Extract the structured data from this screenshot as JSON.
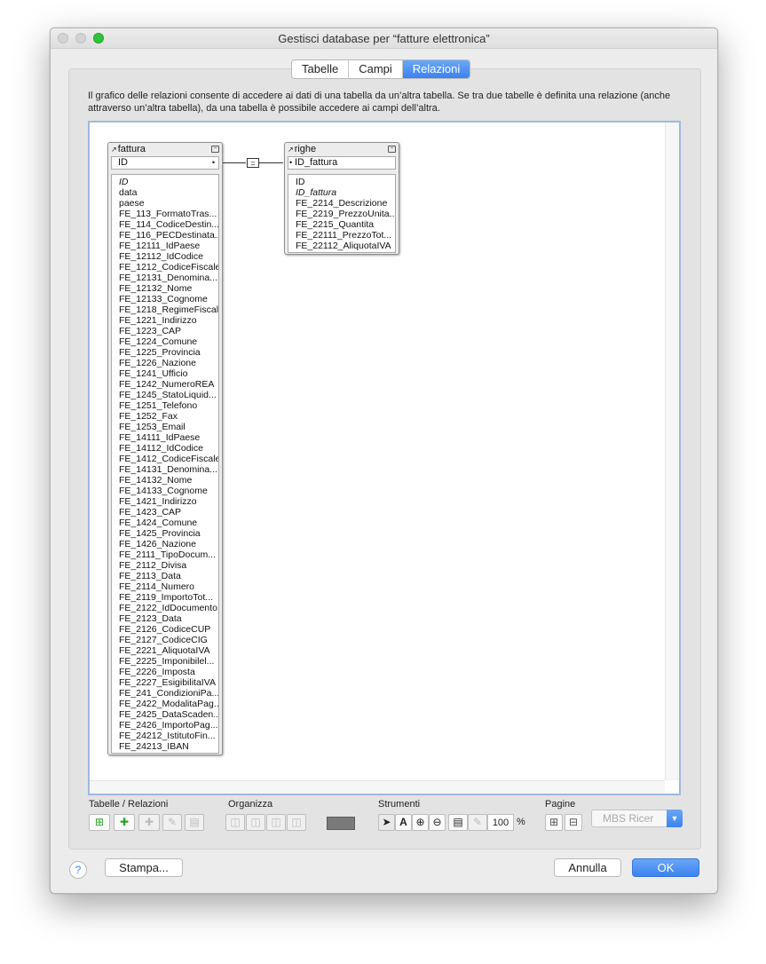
{
  "window": {
    "title": "Gestisci database per “fatture elettronica”"
  },
  "tabs": [
    {
      "label": "Tabelle",
      "active": false
    },
    {
      "label": "Campi",
      "active": false
    },
    {
      "label": "Relazioni",
      "active": true
    }
  ],
  "description": "Il grafico delle relazioni consente di accedere ai dati di una tabella da un’altra tabella. Se tra due tabelle è definita una relazione (anche attraverso un’altra tabella), da una tabella è possibile accedere ai campi dell’altra.",
  "tables": {
    "fattura": {
      "name": "fattura",
      "key_field": "ID",
      "fields": [
        "ID",
        "data",
        "paese",
        "FE_113_FormatoTras...",
        "FE_114_CodiceDestin...",
        "FE_116_PECDestinata...",
        "FE_12111_IdPaese",
        "FE_12112_IdCodice",
        "FE_1212_CodiceFiscale",
        "FE_12131_Denomina...",
        "FE_12132_Nome",
        "FE_12133_Cognome",
        "FE_1218_RegimeFiscale",
        "FE_1221_Indirizzo",
        "FE_1223_CAP",
        "FE_1224_Comune",
        "FE_1225_Provincia",
        "FE_1226_Nazione",
        "FE_1241_Ufficio",
        "FE_1242_NumeroREA",
        "FE_1245_StatoLiquid...",
        "FE_1251_Telefono",
        "FE_1252_Fax",
        "FE_1253_Email",
        "FE_14111_IdPaese",
        "FE_14112_IdCodice",
        "FE_1412_CodiceFiscale",
        "FE_14131_Denomina...",
        "FE_14132_Nome",
        "FE_14133_Cognome",
        "FE_1421_Indirizzo",
        "FE_1423_CAP",
        "FE_1424_Comune",
        "FE_1425_Provincia",
        "FE_1426_Nazione",
        "FE_2111_TipoDocum...",
        "FE_2112_Divisa",
        "FE_2113_Data",
        "FE_2114_Numero",
        "FE_2119_ImportoTot...",
        "FE_2122_IdDocumento",
        "FE_2123_Data",
        "FE_2126_CodiceCUP",
        "FE_2127_CodiceCIG",
        "FE_2221_AliquotaIVA",
        "FE_2225_Imponibilel...",
        "FE_2226_Imposta",
        "FE_2227_EsigibilitaIVA",
        "FE_241_CondizioniPa...",
        "FE_2422_ModalitaPag...",
        "FE_2425_DataScaden...",
        "FE_2426_ImportoPag...",
        "FE_24212_IstitutoFin...",
        "FE_24213_IBAN"
      ]
    },
    "righe": {
      "name": "righe",
      "key_field": "ID_fattura",
      "fields": [
        "ID",
        "ID_fattura",
        "FE_2214_Descrizione",
        "FE_2219_PrezzoUnita...",
        "FE_2215_Quantita",
        "FE_22111_PrezzoTot...",
        "FE_22112_AliquotaIVA"
      ]
    }
  },
  "relationship": {
    "operator": "="
  },
  "toolbar": {
    "groups": {
      "tables_relations": "Tabelle / Relazioni",
      "arrange": "Organizza",
      "tools": "Strumenti",
      "pages": "Pagine"
    },
    "zoom_value": "100",
    "zoom_unit": "%",
    "plugin_popup": "MBS Ricer"
  },
  "footer": {
    "help": "?",
    "print": "Stampa...",
    "cancel": "Annulla",
    "ok": "OK"
  }
}
